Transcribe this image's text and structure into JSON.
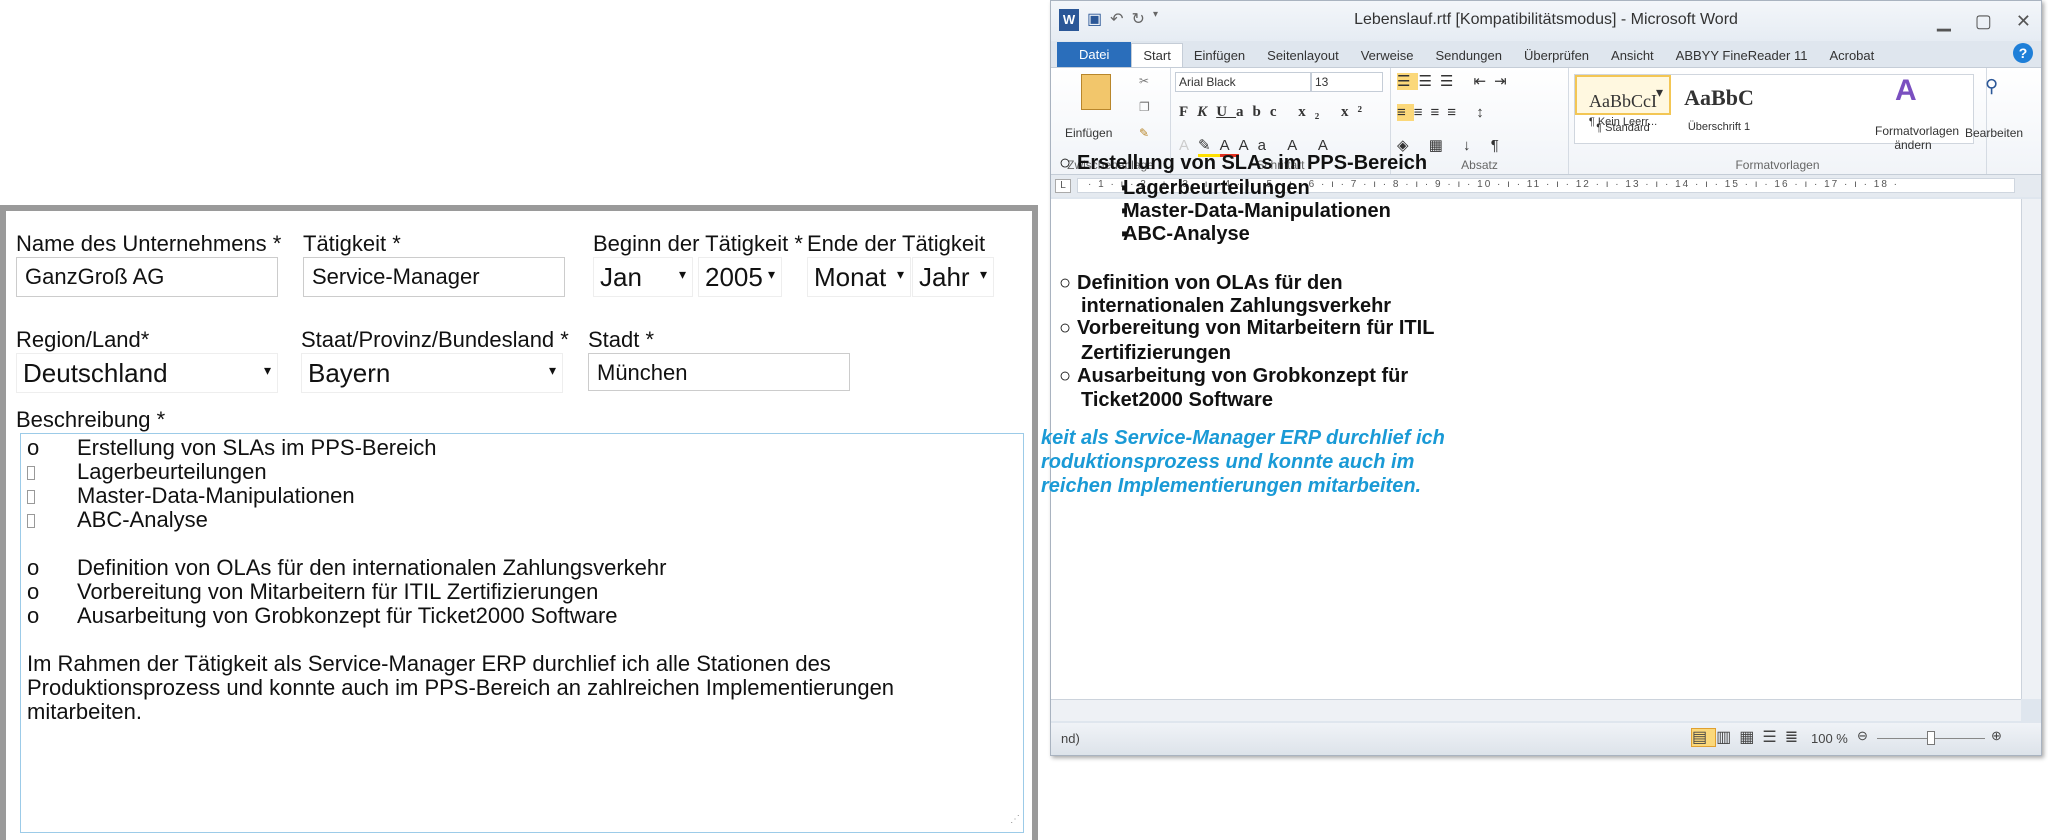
{
  "word": {
    "title": "Lebenslauf.rtf [Kompatibilitätsmodus] - Microsoft Word",
    "tabs": [
      "Datei",
      "Start",
      "Einfügen",
      "Seitenlayout",
      "Verweise",
      "Sendungen",
      "Überprüfen",
      "Ansicht",
      "ABBYY FineReader 11",
      "Acrobat"
    ],
    "font": "Arial Black",
    "size": "13",
    "paste": "Einfügen",
    "groups": {
      "clipboard": "Zwischenablage",
      "font": "Schriftart",
      "paragraph": "Absatz",
      "styles": "Formatvorlagen"
    },
    "styles": [
      {
        "preview": "AaBbCcI",
        "name": "¶ Standard"
      },
      {
        "preview": "AaBbCcI",
        "name": "¶ Kein Leerr..."
      },
      {
        "preview": "AaBbC",
        "name": "Überschrift 1"
      }
    ],
    "change_styles": "Formatvorlagen ändern",
    "edit": "Bearbeiten",
    "ruler": "· 1 · ı · 2 · ı · 3 · ı · 4 · ı · 5 · ı · 6 · ı · 7 · ı · 8 · ı · 9 · ı · 10 · ı · 11 · ı · 12 · ı · 13 · ı · 14 · ı · 15 · ı · 16 · ı · 17 · ı · 18 ·",
    "doc_lines": [
      "Erstellung von SLAs im PPS-Bereich",
      "Lagerbeurteilungen",
      "Master-Data-Manipulationen",
      "ABC-Analyse",
      "Definition von OLAs für den",
      "internationalen Zahlungsverkehr",
      "Vorbereitung von Mitarbeitern für ITIL",
      "Zertifizierungen",
      "Ausarbeitung von Grobkonzept für",
      "Ticket2000 Software"
    ],
    "doc_blue": [
      "keit als Service-Manager ERP durchlief ich",
      "roduktionsprozess und konnte auch im",
      "reichen Implementierungen mitarbeiten."
    ],
    "status_left": "nd)",
    "zoom": "100 %"
  },
  "form": {
    "company_label": "Name des Unternehmens *",
    "company": "GanzGroß AG",
    "job_label": "Tätigkeit *",
    "job": "Service-Manager",
    "start_label": "Beginn der Tätigkeit *",
    "start_month": "Jan",
    "start_year": "2005",
    "end_label": "Ende der Tätigkeit",
    "end_month": "Monat",
    "end_year": "Jahr",
    "region_label": "Region/Land*",
    "region": "Deutschland",
    "state_label": "Staat/Provinz/Bundesland *",
    "state": "Bayern",
    "city_label": "Stadt *",
    "city": "München",
    "desc_label": "Beschreibung *",
    "desc_items": [
      {
        "b": "o",
        "t": "Erstellung von SLAs im PPS-Bereich"
      },
      {
        "b": "glyph",
        "t": "Lagerbeurteilungen"
      },
      {
        "b": "glyph",
        "t": "Master-Data-Manipulationen"
      },
      {
        "b": "glyph",
        "t": "ABC-Analyse"
      },
      {
        "b": "",
        "t": ""
      },
      {
        "b": "o",
        "t": "Definition von OLAs für den internationalen Zahlungsverkehr"
      },
      {
        "b": "o",
        "t": "Vorbereitung von Mitarbeitern für ITIL Zertifizierungen"
      },
      {
        "b": "o",
        "t": "Ausarbeitung von Grobkonzept für Ticket2000 Software"
      }
    ],
    "desc_para": "Im Rahmen der Tätigkeit als Service-Manager ERP durchlief ich alle Stationen des Produktionsprozess und konnte auch im PPS-Bereich an zahlreichen Implementierungen mitarbeiten."
  }
}
